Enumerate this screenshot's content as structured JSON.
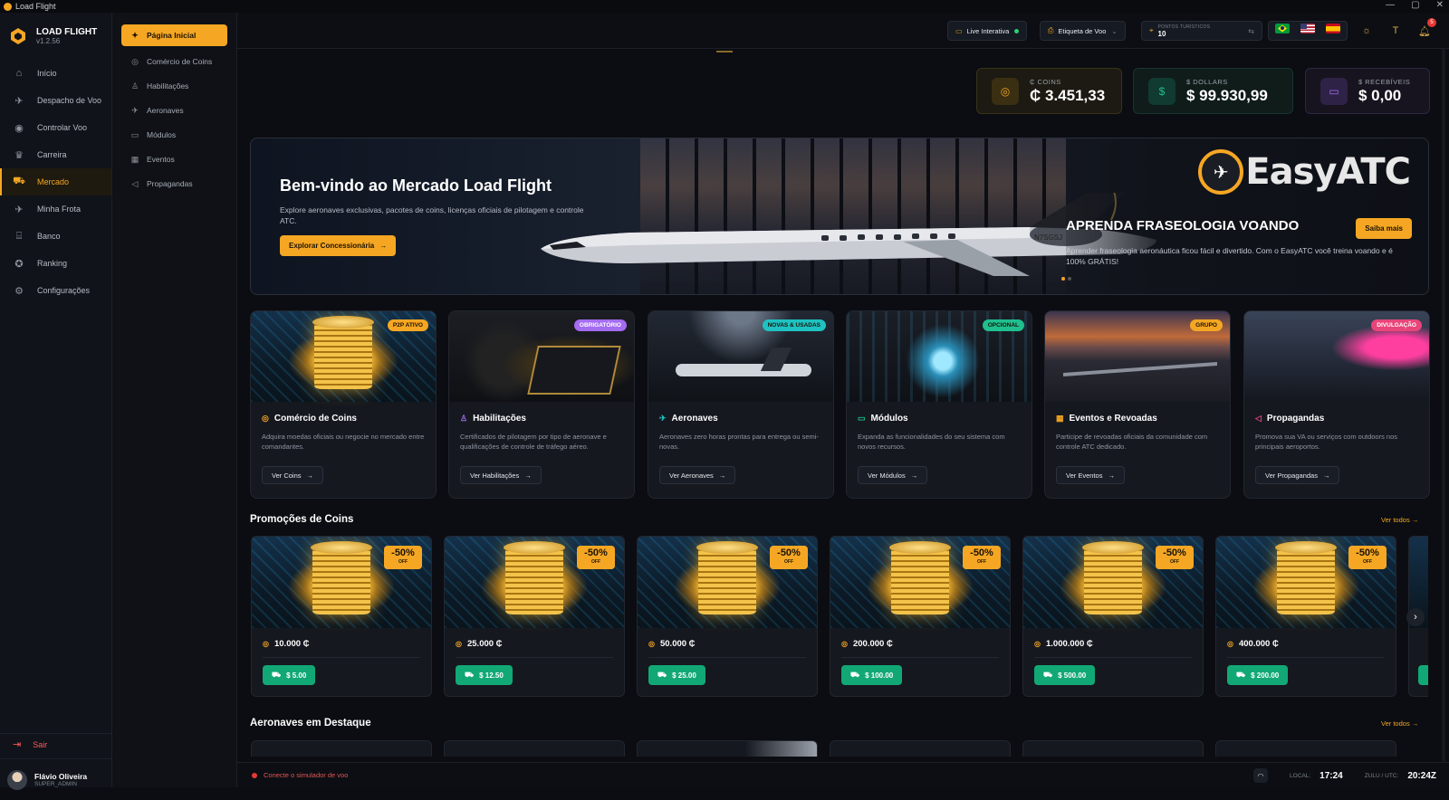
{
  "window": {
    "title": "Load Flight"
  },
  "brand": {
    "name": "LOAD FLIGHT",
    "version": "v1.2.56"
  },
  "sidebar": {
    "items": [
      {
        "label": "Início",
        "icon": "home-icon"
      },
      {
        "label": "Despacho de Voo",
        "icon": "dispatch-icon"
      },
      {
        "label": "Controlar Voo",
        "icon": "radio-icon"
      },
      {
        "label": "Carreira",
        "icon": "trophy-icon"
      },
      {
        "label": "Mercado",
        "icon": "cart-icon",
        "active": true
      },
      {
        "label": "Minha Frota",
        "icon": "plane-icon"
      },
      {
        "label": "Banco",
        "icon": "bank-icon"
      },
      {
        "label": "Ranking",
        "icon": "medal-icon"
      },
      {
        "label": "Configurações",
        "icon": "gear-icon"
      }
    ],
    "logout": "Sair",
    "user": {
      "name": "Flávio Oliveira",
      "role": "SUPER_ADMIN"
    }
  },
  "subnav": {
    "items": [
      {
        "label": "Página Inicial",
        "active": true
      },
      {
        "label": "Comércio de Coins"
      },
      {
        "label": "Habilitações"
      },
      {
        "label": "Aeronaves"
      },
      {
        "label": "Módulos"
      },
      {
        "label": "Eventos"
      },
      {
        "label": "Propagandas"
      }
    ]
  },
  "topbar": {
    "live_label": "Live Interativa",
    "tag_label": "Etiqueta de Voo",
    "points_label": "PONTOS TURÍSTICOS",
    "points_value": "10",
    "notifications": "5"
  },
  "balances": [
    {
      "label": "₵ COINS",
      "value": "₵ 3.451,33",
      "color": "#f5a623"
    },
    {
      "label": "$ DOLLARS",
      "value": "$ 99.930,99",
      "color": "#1fbf8f"
    },
    {
      "label": "$ RECEBÍVEIS",
      "value": "$ 0,00",
      "color": "#a46cf0"
    }
  ],
  "hero": {
    "title": "Bem-vindo ao Mercado Load Flight",
    "desc": "Explore aeronaves exclusivas, pacotes de coins, licenças oficiais de pilotagem e controle ATC.",
    "button": "Explorar Concessionária",
    "promo_logo": "EasyATC",
    "promo_title": "APRENDA FRASEOLOGIA VOANDO",
    "promo_desc": "Aprender fraseologia aeronáutica ficou fácil e divertido. Com o EasyATC você treina voando e é 100% GRÁTIS!",
    "promo_button": "Saiba mais",
    "tail_number": "N7SGSJ"
  },
  "categories": [
    {
      "title": "Comércio de Coins",
      "badge": "P2P ATIVO",
      "badge_color": "#f5a623",
      "desc": "Adquira moedas oficiais ou negocie no mercado entre comandantes.",
      "button": "Ver Coins"
    },
    {
      "title": "Habilitações",
      "badge": "OBRIGATÓRIO",
      "badge_color": "#a46cf0",
      "desc": "Certificados de pilotagem por tipo de aeronave e qualificações de controle de tráfego aéreo.",
      "button": "Ver Habilitações"
    },
    {
      "title": "Aeronaves",
      "badge": "NOVAS & USADAS",
      "badge_color": "#1fc2c2",
      "desc": "Aeronaves zero horas prontas para entrega ou semi-novas.",
      "button": "Ver Aeronaves"
    },
    {
      "title": "Módulos",
      "badge": "OPCIONAL",
      "badge_color": "#1fbf8f",
      "desc": "Expanda as funcionalidades do seu sistema com novos recursos.",
      "button": "Ver Módulos"
    },
    {
      "title": "Eventos e Revoadas",
      "badge": "GRUPO",
      "badge_color": "#f5a623",
      "desc": "Participe de revoadas oficiais da comunidade com controle ATC dedicado.",
      "button": "Ver Eventos"
    },
    {
      "title": "Propagandas",
      "badge": "DIVULGAÇÃO",
      "badge_color": "#e8457a",
      "desc": "Promova sua VA ou serviços com outdoors nos principais aeroportos.",
      "button": "Ver Propagandas"
    }
  ],
  "promos": {
    "title": "Promoções de Coins",
    "see_all": "Ver todos",
    "discount": "-50%",
    "discount_sub": "OFF",
    "items": [
      {
        "amount": "10.000 ₵",
        "price": "$ 5.00"
      },
      {
        "amount": "25.000 ₵",
        "price": "$ 12.50"
      },
      {
        "amount": "50.000 ₵",
        "price": "$ 25.00"
      },
      {
        "amount": "200.000 ₵",
        "price": "$ 100.00"
      },
      {
        "amount": "1.000.000 ₵",
        "price": "$ 500.00"
      },
      {
        "amount": "400.000 ₵",
        "price": "$ 200.00"
      }
    ]
  },
  "featured": {
    "title": "Aeronaves em Destaque",
    "see_all": "Ver todos"
  },
  "status": {
    "sim": "Conecte o simulador de voo",
    "local_label": "LOCAL:",
    "local_time": "17:24",
    "zulu_label": "ZULU / UTC:",
    "zulu_time": "20:24Z"
  }
}
